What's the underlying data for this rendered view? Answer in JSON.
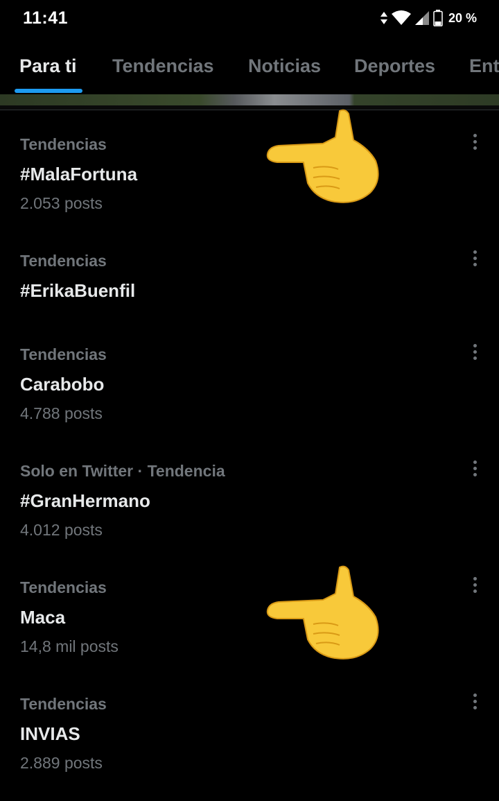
{
  "status_bar": {
    "time": "11:41",
    "battery": "20 %",
    "icons": [
      "data-arrows-icon",
      "wifi-icon",
      "signal-icon",
      "battery-icon"
    ]
  },
  "tabs": [
    {
      "label": "Para ti",
      "active": true
    },
    {
      "label": "Tendencias",
      "active": false
    },
    {
      "label": "Noticias",
      "active": false
    },
    {
      "label": "Deportes",
      "active": false
    },
    {
      "label": "Ent",
      "active": false
    }
  ],
  "trends": [
    {
      "context": "Tendencias",
      "name": "#MalaFortuna",
      "count": "2.053 posts"
    },
    {
      "context": "Tendencias",
      "name": "#ErikaBuenfil",
      "count": ""
    },
    {
      "context": "Tendencias",
      "name": "Carabobo",
      "count": "4.788 posts"
    },
    {
      "context": "Solo en Twitter · Tendencia",
      "name": "#GranHermano",
      "count": "4.012 posts"
    },
    {
      "context": "Tendencias",
      "name": "Maca",
      "count": "14,8 mil posts"
    },
    {
      "context": "Tendencias",
      "name": "INVIAS",
      "count": "2.889 posts"
    }
  ],
  "annotations": {
    "pointer_emoji": "backhand-index-pointing-left-icon",
    "pointed_trends": [
      "#MalaFortuna",
      "Maca"
    ]
  },
  "colors": {
    "background": "#000000",
    "primary_text": "#e7e9ea",
    "secondary_text": "#71767b",
    "accent": "#1d9bf0"
  }
}
